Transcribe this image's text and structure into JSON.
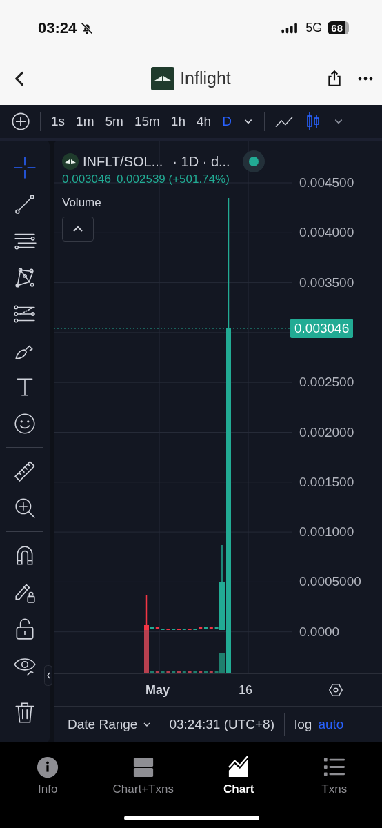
{
  "status_bar": {
    "time": "03:24",
    "network": "5G",
    "battery": "68"
  },
  "nav": {
    "title": "Inflight"
  },
  "toolbar": {
    "timeframes": [
      {
        "label": "1s",
        "selected": false
      },
      {
        "label": "1m",
        "selected": false
      },
      {
        "label": "5m",
        "selected": false
      },
      {
        "label": "15m",
        "selected": false
      },
      {
        "label": "1h",
        "selected": false
      },
      {
        "label": "4h",
        "selected": false
      },
      {
        "label": "D",
        "selected": true
      }
    ],
    "chart_types": [
      {
        "kind": "line",
        "selected": false
      },
      {
        "kind": "candles",
        "selected": true
      }
    ]
  },
  "drawing_tools": [
    {
      "kind": "crosshair",
      "selected": true
    },
    {
      "kind": "trendline",
      "selected": false
    },
    {
      "kind": "lines",
      "selected": false
    },
    {
      "kind": "pattern",
      "selected": false
    },
    {
      "kind": "fib",
      "selected": false
    },
    {
      "kind": "brush",
      "selected": false
    },
    {
      "kind": "text",
      "selected": false
    },
    {
      "kind": "emoji",
      "selected": false
    },
    {
      "kind": "divider"
    },
    {
      "kind": "ruler",
      "selected": false
    },
    {
      "kind": "zoom",
      "selected": false
    },
    {
      "kind": "divider"
    },
    {
      "kind": "magnet",
      "selected": false
    },
    {
      "kind": "lock-draw",
      "selected": false
    },
    {
      "kind": "lock",
      "selected": false
    },
    {
      "kind": "eye",
      "selected": false
    },
    {
      "kind": "divider"
    },
    {
      "kind": "trash",
      "selected": false
    }
  ],
  "chart": {
    "symbol": "INFLT/SOL...",
    "interval": "· 1D · d...",
    "last_price": "0.003046",
    "change": "0.002539 (+501.74%)",
    "volume_label": "Volume",
    "price_axis": [
      "0.004500",
      "0.004000",
      "0.003500",
      "0.002500",
      "0.002000",
      "0.001500",
      "0.001000",
      "0.0005000",
      "0.0000"
    ],
    "price_tag": "0.003046",
    "time_axis": [
      {
        "label": "May",
        "bold": true
      },
      {
        "label": "16",
        "bold": false
      }
    ]
  },
  "footer": {
    "date_range": "Date Range",
    "clock": "03:24:31 (UTC+8)",
    "scales": [
      {
        "label": "log",
        "selected": false
      },
      {
        "label": "auto",
        "selected": true
      }
    ]
  },
  "tabs": [
    {
      "label": "Info",
      "kind": "info",
      "selected": false
    },
    {
      "label": "Chart+Txns",
      "kind": "split",
      "selected": false
    },
    {
      "label": "Chart",
      "kind": "chart",
      "selected": true
    },
    {
      "label": "Txns",
      "kind": "list",
      "selected": false
    }
  ]
}
